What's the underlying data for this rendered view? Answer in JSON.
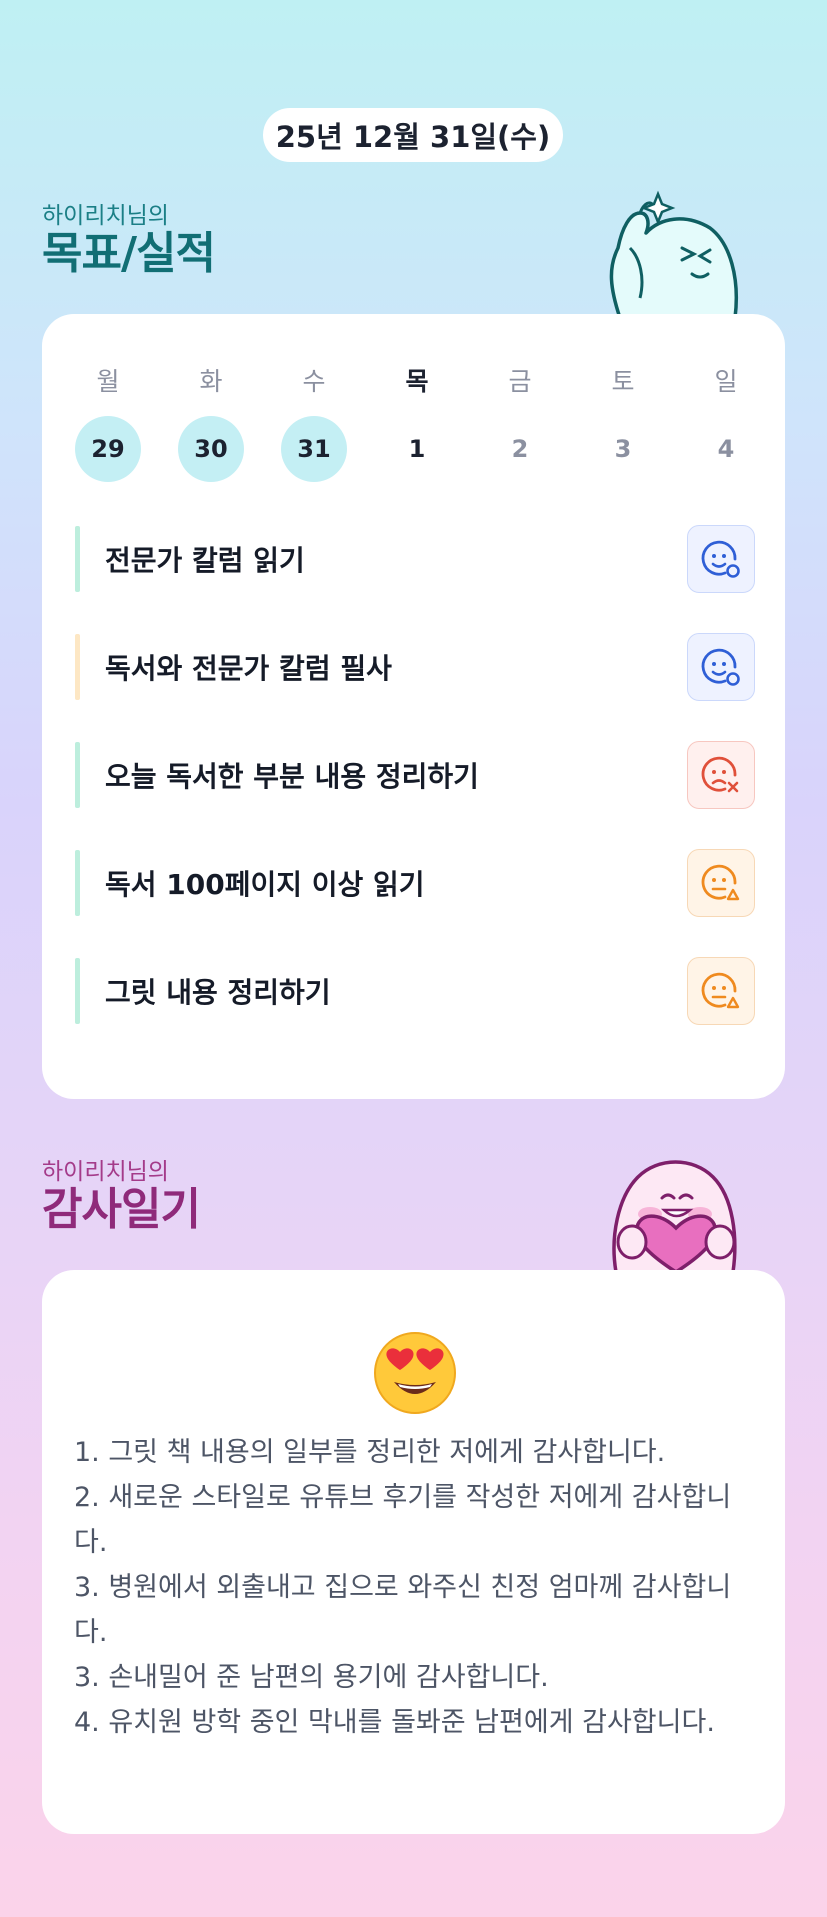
{
  "header": {
    "date": "25년 12월 31일(수)"
  },
  "goals_section": {
    "subtitle": "하이리치님의",
    "title": "목표/실적",
    "week": [
      {
        "label": "월",
        "date": "29",
        "state": "done"
      },
      {
        "label": "화",
        "date": "30",
        "state": "done"
      },
      {
        "label": "수",
        "date": "31",
        "state": "done"
      },
      {
        "label": "목",
        "date": "1",
        "state": "today"
      },
      {
        "label": "금",
        "date": "2",
        "state": "future"
      },
      {
        "label": "토",
        "date": "3",
        "state": "future"
      },
      {
        "label": "일",
        "date": "4",
        "state": "future"
      }
    ],
    "items": [
      {
        "text": "전문가 칼럼 읽기",
        "status": "success-icon",
        "bar_color": "#bdeedd"
      },
      {
        "text": "독서와 전문가 칼럼 필사",
        "status": "success-icon",
        "bar_color": "#fde7c4"
      },
      {
        "text": "오늘 독서한 부분 내용 정리하기",
        "status": "fail-icon",
        "bar_color": "#bdeedd"
      },
      {
        "text": "독서 100페이지 이상 읽기",
        "status": "partial-icon",
        "bar_color": "#bdeedd"
      },
      {
        "text": "그릿 내용 정리하기",
        "status": "partial-icon",
        "bar_color": "#bdeedd"
      }
    ]
  },
  "thanks_section": {
    "subtitle": "하이리치님의",
    "title": "감사일기",
    "mood_icon": "heart-eyes-emoji-icon",
    "lines": [
      "1. 그릿 책 내용의 일부를 정리한 저에게 감사합니다.",
      "2. 새로운 스타일로 유튜브 후기를 작성한 저에게 감사합니다.",
      "3. 병원에서 외출내고 집으로 와주신 친정 엄마께 감사합니다.",
      "3. 손내밀어 준 남편의 용기에 감사합니다.",
      "4. 유치원 방학 중인 막내를 돌봐준 남편에게 감사합니다."
    ]
  },
  "colors": {
    "success": "#2f5fd6",
    "fail": "#e0503a",
    "partial": "#ef8a1f",
    "done_day": "#c4eff4"
  }
}
